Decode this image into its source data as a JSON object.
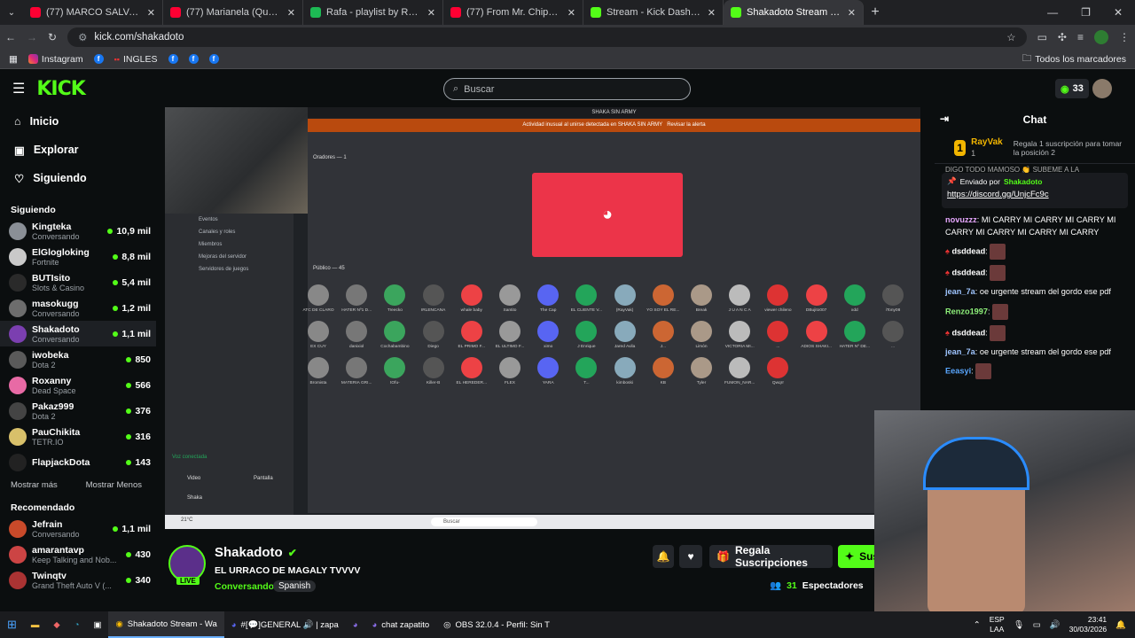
{
  "tabs": [
    {
      "title": "(77) MARCO SALVA A GRACE D",
      "color": "#ff0033"
    },
    {
      "title": "(77) Marianela (Que Pasa) (Exte",
      "color": "#ff0033"
    },
    {
      "title": "Rafa - playlist by RafaelLxared |",
      "color": "#1db954"
    },
    {
      "title": "(77) From Mr. Chips to Scarface",
      "color": "#ff0033"
    },
    {
      "title": "Stream - Kick Dashboard",
      "color": "#53fc18"
    },
    {
      "title": "Shakadoto Stream - Watch",
      "color": "#53fc18"
    }
  ],
  "url": "kick.com/shakadoto",
  "bookmarks": {
    "items": [
      "Instagram",
      "INGLES"
    ],
    "all_label": "Todos los marcadores"
  },
  "kick": {
    "search_placeholder": "Buscar",
    "viewer_count": "33",
    "brand_color": "#53fc18",
    "nav": [
      "Inicio",
      "Explorar",
      "Siguiendo"
    ],
    "following_title": "Siguiendo",
    "following": [
      {
        "name": "Kingteka",
        "game": "Conversando",
        "viewers": "10,9 mil",
        "color": "#8a8f96"
      },
      {
        "name": "ElGlogloking",
        "game": "Fortnite",
        "viewers": "8,8 mil",
        "color": "#c9c9c9"
      },
      {
        "name": "BUTIsito",
        "game": "Slots & Casino",
        "viewers": "5,4 mil",
        "color": "#2a2a2a"
      },
      {
        "name": "masokugg",
        "game": "Conversando",
        "viewers": "1,2 mil",
        "color": "#6d6d6d"
      },
      {
        "name": "Shakadoto",
        "game": "Conversando",
        "viewers": "1,1 mil",
        "color": "#7b3fb0"
      },
      {
        "name": "iwobeka",
        "game": "Dota 2",
        "viewers": "850",
        "color": "#5a5a5a"
      },
      {
        "name": "Roxanny",
        "game": "Dead Space",
        "viewers": "566",
        "color": "#e86aa5"
      },
      {
        "name": "Pakaz999",
        "game": "Dota 2",
        "viewers": "376",
        "color": "#444"
      },
      {
        "name": "PauChikita",
        "game": "TETR.IO",
        "viewers": "316",
        "color": "#d8c06a"
      },
      {
        "name": "FlapjackDota",
        "game": "",
        "viewers": "143",
        "color": "#222"
      }
    ],
    "show_more": "Mostrar más",
    "show_less": "Mostrar Menos",
    "recommended_title": "Recomendado",
    "recommended": [
      {
        "name": "Jefrain",
        "game": "Conversando",
        "viewers": "1,1 mil",
        "color": "#c94a2a"
      },
      {
        "name": "amarantavp",
        "game": "Keep Talking and Nob...",
        "viewers": "430",
        "color": "#c44"
      },
      {
        "name": "Twinqtv",
        "game": "Grand Theft Auto V (...",
        "viewers": "340",
        "color": "#a33"
      }
    ]
  },
  "stream": {
    "discord_title": "SHAKA SIN ARMY",
    "discord_alert": "Actividad inusual al unirse detectada en SHAKA SIN ARMY",
    "discord_alert_action": "Revisar la alerta",
    "speakers_label": "Oradores — 1",
    "audience_label": "Público — 45",
    "side_items": [
      "Eventos",
      "Canales y roles",
      "Miembros",
      "Mejoras del servidor",
      "Servidores de juegos"
    ],
    "voice_connected": "Voz conectada",
    "video_label": "Video",
    "screen_label": "Pantalla",
    "discord_user": "Shaka",
    "member_names": [
      "ATC DE CLARO",
      "HATER Nº1 D...",
      "Treecko",
      "IRLENCANA",
      "whale baby",
      "Santito",
      "The Cap",
      "EL CLIENTE V...",
      "(RayVak)",
      "YO SOY EL RE...",
      "Break",
      "J U A N C A",
      "viewer chileno",
      "DBujito007",
      "xdd",
      "iTony08",
      "EX CUY",
      "danixiol",
      "Cochabambino",
      "Diego",
      "EL PRIMO F...",
      "EL ULTIMO F...",
      "ximo",
      "J Enrique",
      "Jared Avila",
      "J...",
      "Limón",
      "VICTORIA MI...",
      "...",
      "ADIOS SHAKI...",
      "HATER Nº DE...",
      "...",
      "Bromista",
      "MATERIA GRI...",
      "tOfu-",
      "Killer-B",
      "EL HEREDER...",
      "FLEX",
      "YARA",
      "T...",
      "kimboski",
      "KB",
      "Tyler",
      "FUMON_NAR...",
      "Qwqrr"
    ],
    "taskbar_search": "Buscar",
    "weather": "21°C"
  },
  "channel": {
    "name": "Shakadoto",
    "title": "EL URRACO DE MAGALY TVVVV",
    "category": "Conversando",
    "language": "Spanish",
    "live_badge": "LIVE",
    "gift_button": "Regala Suscripciones",
    "sub_button": "Sus",
    "viewers": "31",
    "viewers_label": "Espectadores"
  },
  "chat": {
    "title": "Chat",
    "top_gifter": "RayVak",
    "top_gifter_rank": "1",
    "top_gifter_count": "1",
    "gift_prompt": "Regala 1 suscripción para tomar la posición 2",
    "overflow_text": "DIGO TODO MAMOSO 👏 SUBEME A LA",
    "pinned_by": "Enviado por",
    "pinned_user": "Shakadoto",
    "pinned_link": "https://discord.gg/UnjcFc9c",
    "messages": [
      {
        "user": "novuzzz",
        "color": "#e7a7ff",
        "text": "MI CARRY MI CARRY MI CARRY MI CARRY MI CARRY MI CARRY MI CARRY"
      },
      {
        "user": "dsddead",
        "color": "#ffffff",
        "text": ""
      },
      {
        "user": "dsddead",
        "color": "#ffffff",
        "text": ""
      },
      {
        "user": "jean_7a",
        "color": "#9fc5ff",
        "text": "oe urgente stream del gordo ese pdf"
      },
      {
        "user": "Renzo1997",
        "color": "#8ef07a",
        "text": ""
      },
      {
        "user": "dsddead",
        "color": "#ffffff",
        "text": ""
      },
      {
        "user": "jean_7a",
        "color": "#9fc5ff",
        "text": "oe urgente stream del gordo ese pdf"
      },
      {
        "user": "Eeasyi",
        "color": "#5aa7ff",
        "text": ""
      }
    ]
  },
  "taskbar": {
    "apps": [
      "Shakadoto Stream - Wa",
      "#[💬]GENERAL 🔊 | zapa",
      "",
      "chat zapatito",
      "OBS 32.0.4 - Perfil: Sin T"
    ],
    "lang": "ESP",
    "lang2": "LAA",
    "time": "23:41",
    "date": "30/03/2026"
  }
}
